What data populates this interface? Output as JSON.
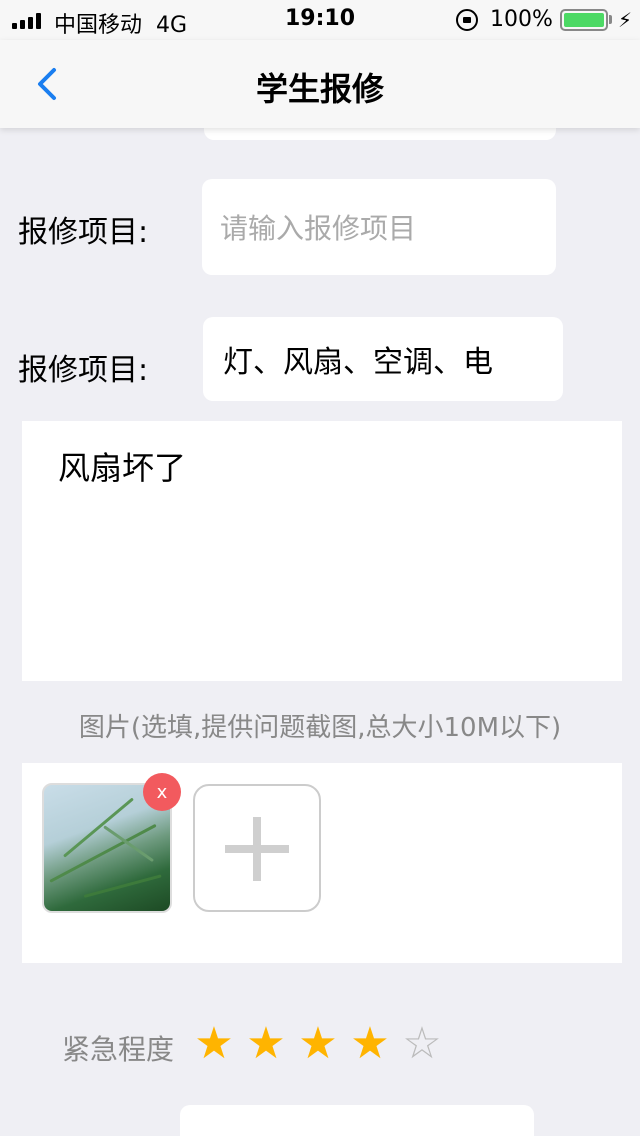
{
  "status_bar": {
    "carrier": "中国移动",
    "network": "4G",
    "time": "19:10",
    "battery_percent": "100%",
    "battery_color": "#4cd964"
  },
  "nav": {
    "title": "学生报修",
    "back_icon": "chevron-left-icon",
    "accent_color": "#1a7ef0"
  },
  "form": {
    "item_label": "报修项目:",
    "item_placeholder": "请输入报修项目",
    "type_label": "报修项目:",
    "type_value": "灯、风扇、空调、电",
    "description": "风扇坏了",
    "photo_hint": "图片(选填,提供问题截图,总大小10M以下)",
    "remove_label": "x",
    "urgency_label": "紧急程度",
    "urgency_max": 5,
    "urgency_value": 4,
    "star_color": "#ffb400"
  }
}
